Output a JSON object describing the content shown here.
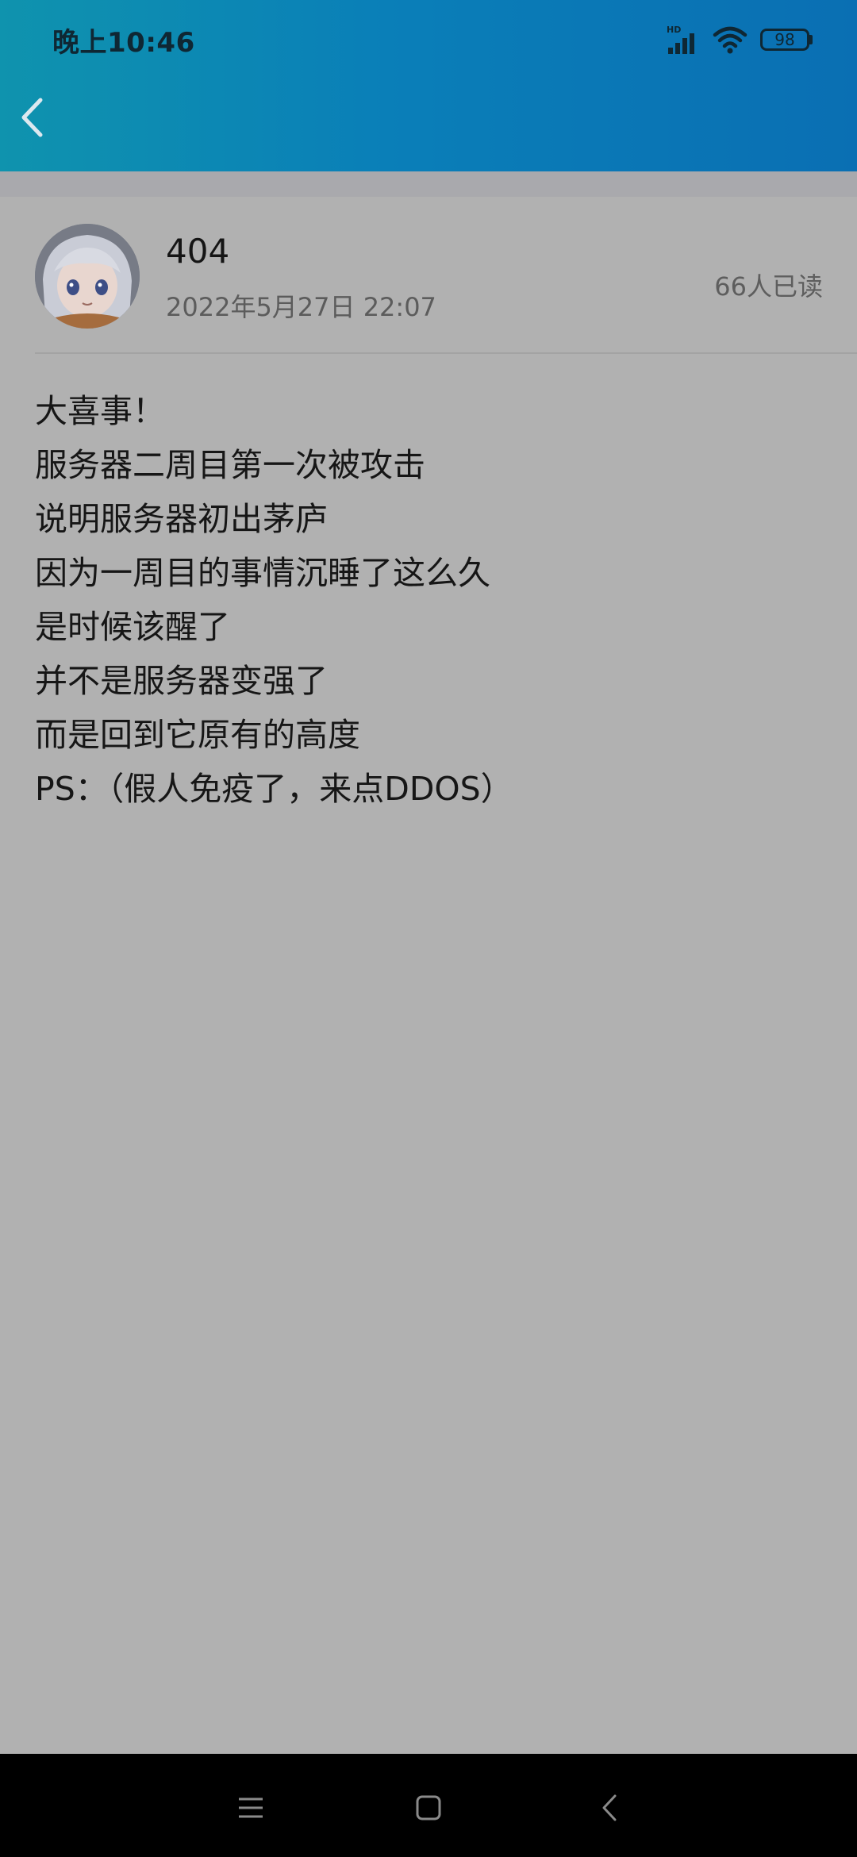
{
  "status_bar": {
    "time": "晚上10:46",
    "network_label": "HD",
    "battery_level": "98",
    "icons": [
      "signal-icon",
      "wifi-icon",
      "battery-icon"
    ]
  },
  "header": {
    "back_icon": "chevron-left-icon",
    "accent_colors": [
      "#0f93ae",
      "#0a6fb3"
    ]
  },
  "post": {
    "author": "404",
    "date": "2022年5月27日 22:07",
    "read_count": "66人已读",
    "lines": [
      "大喜事！",
      "服务器二周目第一次被攻击",
      "说明服务器初出茅庐",
      "因为一周目的事情沉睡了这么久",
      "是时候该醒了",
      "并不是服务器变强了",
      "而是回到它原有的高度",
      "PS：（假人免疫了，来点DDOS）"
    ]
  },
  "nav_bar": {
    "icons": [
      "menu-icon",
      "home-icon",
      "back-icon"
    ]
  }
}
